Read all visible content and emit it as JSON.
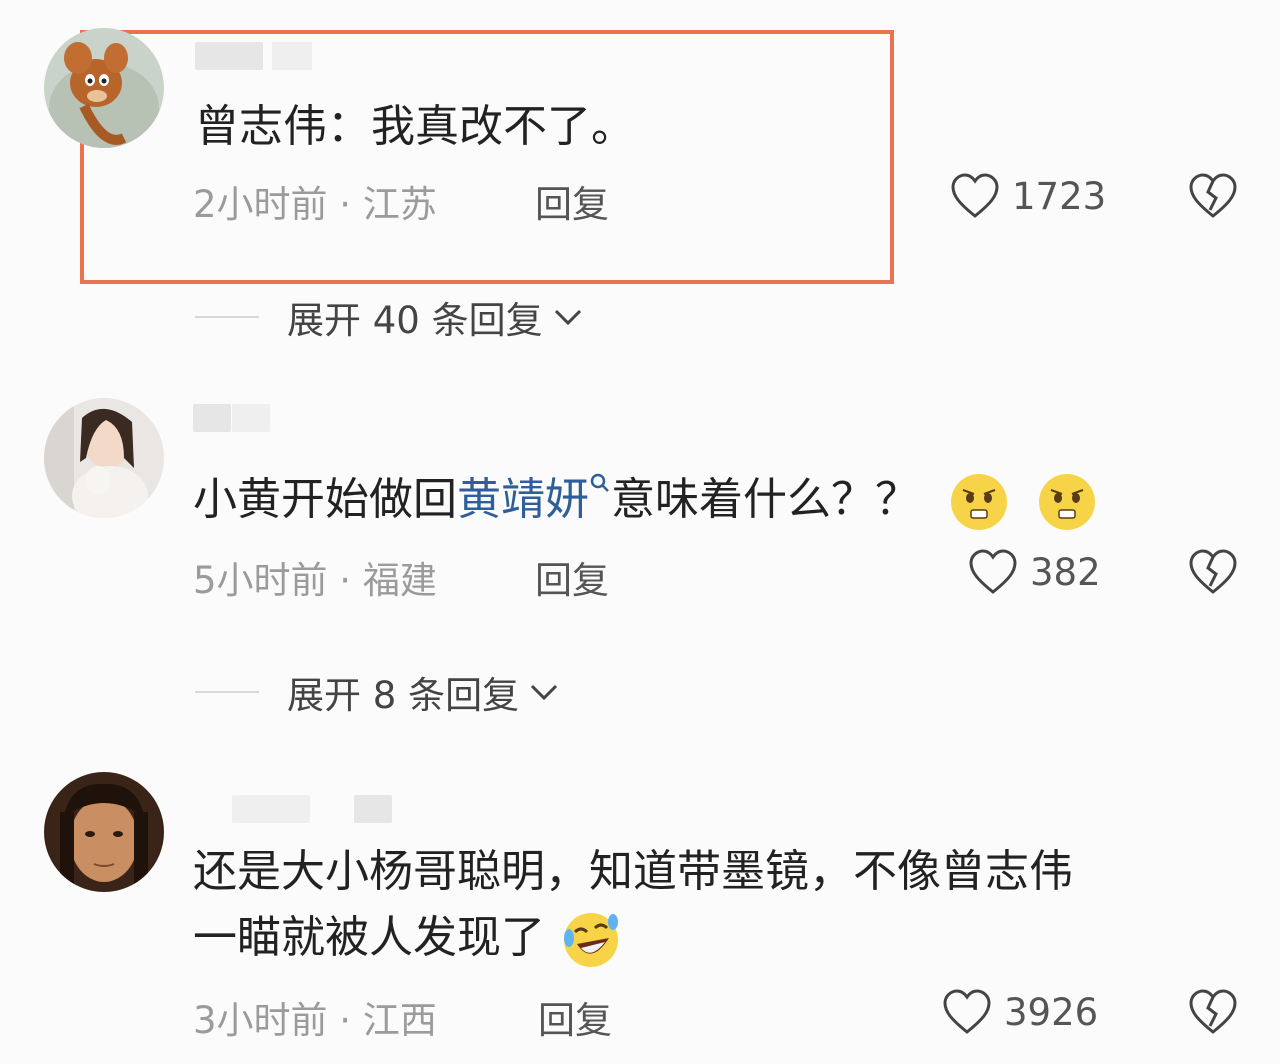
{
  "comments": [
    {
      "text": "曾志伟：我真改不了。",
      "time_location": "2小时前 · 江苏",
      "reply_label": "回复",
      "likes": "1723",
      "expand": "展开 40 条回复",
      "avatar_icon": "cartoon-mouse-avatar"
    },
    {
      "text_before": "小黄开始做回",
      "text_link": "黄靖妍",
      "text_after": "意味着什么？？",
      "time_location": "5小时前 · 福建",
      "reply_label": "回复",
      "likes": "382",
      "expand": "展开 8 条回复",
      "avatar_icon": "woman-photo-avatar",
      "emojis": [
        "worried-emoji",
        "worried-emoji"
      ]
    },
    {
      "text_line1": "还是大小杨哥聪明，知道带墨镜，不像曾志伟",
      "text_line2": "一瞄就被人发现了",
      "time_location": "3小时前 · 江西",
      "reply_label": "回复",
      "likes": "3926",
      "avatar_icon": "man-photo-avatar",
      "emojis": [
        "laughing-crying-emoji"
      ]
    }
  ],
  "colors": {
    "highlight_border": "#e9734f",
    "link": "#2f5f9a",
    "meta": "#9b9b9b"
  }
}
